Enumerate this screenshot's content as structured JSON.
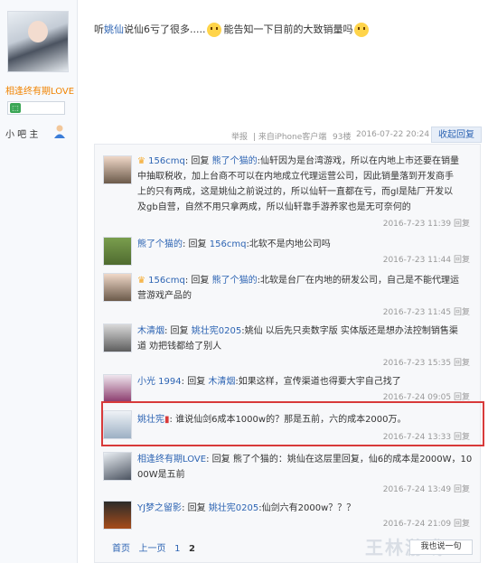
{
  "author": {
    "name": "相逢终有期LOVE",
    "level_value": "",
    "badge": "小 吧 主"
  },
  "post": {
    "text_1": "听",
    "mention": "姚仙",
    "text_2": "说仙6亏了很多.....",
    "text_3": "能告知一下目前的大致销量吗"
  },
  "meta": {
    "report": "举报",
    "source": "| 来自iPhone客户端",
    "floor": "93楼",
    "time": "2016-07-22 20:24",
    "collapse": "收起回复"
  },
  "comments": [
    {
      "user": "156cmq",
      "reply_word": ": 回复",
      "reply_to": "熊了个猫的",
      "lines": [
        ":仙轩因为是台湾游戏，所以在内地上市还要在销量",
        "中抽取税收，加上台商不可以在内地成立代理运营公司，因此销量落到开发商手",
        "上的只有两成，这是姚仙之前说过的，所以仙轩一直都在亏，而gl是陆厂开发以",
        "及gb自营，自然不用只拿两成，所以仙轩靠手游养家也是无可奈何的"
      ],
      "time": "2016-7-23 11:39",
      "reply": "回复"
    },
    {
      "user": "熊了个猫的",
      "reply_word": ": 回复",
      "reply_to": "156cmq",
      "lines": [
        ":北软不是内地公司吗"
      ],
      "time": "2016-7-23 11:44",
      "reply": "回复"
    },
    {
      "user": "156cmq",
      "reply_word": ": 回复",
      "reply_to": "熊了个猫的",
      "lines": [
        ":北软是台厂在内地的研发公司，自己是不能代理运",
        "营游戏产品的"
      ],
      "time": "2016-7-23 11:45",
      "reply": "回复"
    },
    {
      "user": "木清烟",
      "reply_word": ": 回复",
      "reply_to": "姚壮宪0205",
      "lines": [
        ":姚仙 以后先只卖数字版 实体版还是想办法控制销售渠",
        "道 劝把钱都给了别人"
      ],
      "time": "2016-7-23 15:35",
      "reply": "回复"
    },
    {
      "user": "小光 1994",
      "reply_word": ": 回复",
      "reply_to": "木清烟",
      "lines": [
        ":如果这样，宣传渠道也得要大宇自己找了"
      ],
      "time": "2016-7-24 09:05",
      "reply": "回复"
    },
    {
      "user": "姚壮宪",
      "reply_word": ":",
      "reply_to": "",
      "lines": [
        "谁说仙剑6成本1000w的？那是五前，六的成本2000万。"
      ],
      "time": "2016-7-24 13:33",
      "reply": "回复"
    },
    {
      "user": "相逢终有期LOVE",
      "reply_word": ": 回复",
      "reply_to": "",
      "lines": [
        "熊了个猫的：姚仙在这层里回复，仙6的成本是2000W，10",
        "00W是五前"
      ],
      "time": "2016-7-24 13:49",
      "reply": "回复"
    },
    {
      "user": "YJ梦之留影",
      "reply_word": ": 回复",
      "reply_to": "姚壮宪0205",
      "lines": [
        ":仙剑六有2000w？？？"
      ],
      "time": "2016-7-24 21:09",
      "reply": "回复"
    }
  ],
  "pager": {
    "first": "首页",
    "prev": "上一页",
    "p1": "1",
    "p2": "2",
    "reply_box": "我也说一句"
  },
  "watermark": "王林游戏"
}
